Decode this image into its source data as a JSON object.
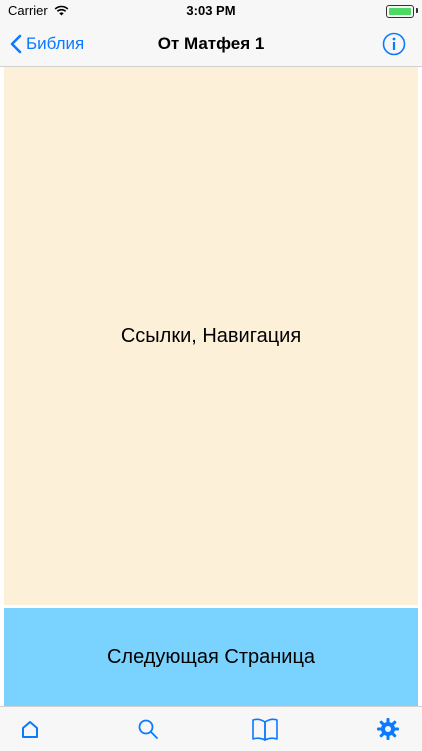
{
  "status_bar": {
    "carrier": "Carrier",
    "time": "3:03 PM"
  },
  "nav": {
    "back_label": "Библия",
    "title": "От Матфея 1"
  },
  "content": {
    "text": "Ссылки, Навигация"
  },
  "next_page": {
    "label": "Следующая Страница"
  },
  "tabs": [
    {
      "icon": "home-icon"
    },
    {
      "icon": "search-icon"
    },
    {
      "icon": "book-icon"
    },
    {
      "icon": "gear-icon"
    }
  ],
  "colors": {
    "accent": "#0a7aff",
    "content_bg": "#fdf0d8",
    "next_page_bg": "#7ad3ff"
  }
}
